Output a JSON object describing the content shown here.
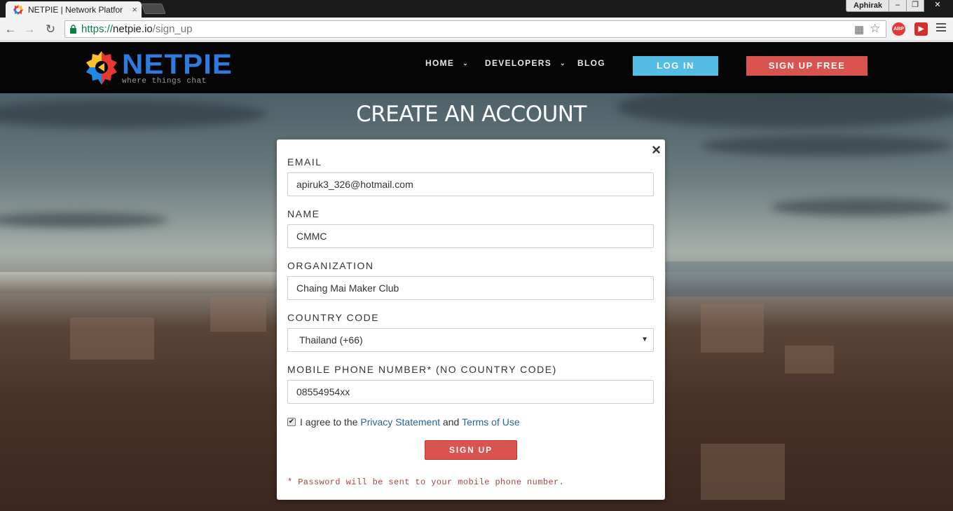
{
  "browser": {
    "tab_title": "NETPIE | Network Platfor",
    "tab_close": "×",
    "profile_name": "Aphirak",
    "url_scheme": "https://",
    "url_host": "netpie.io",
    "url_path": "/sign_up",
    "icons": [
      "back-icon",
      "forward-icon",
      "reload-icon",
      "lock-icon",
      "translate-icon",
      "star-icon",
      "adblock-icon",
      "extension-icon",
      "menu-icon"
    ],
    "adblock_label": "ABP"
  },
  "site": {
    "logo_text": "NETPIE",
    "logo_tagline": "where things chat",
    "nav": [
      {
        "label": "HOME",
        "has_dropdown": true
      },
      {
        "label": "DEVELOPERS",
        "has_dropdown": true
      },
      {
        "label": "BLOG",
        "has_dropdown": false
      }
    ],
    "login_label": "LOG IN",
    "signup_label": "SIGN UP FREE",
    "colors": {
      "login": "#54bde4",
      "signup": "#d9534f",
      "header_bg": "#050505"
    }
  },
  "page": {
    "title": "CREATE AN ACCOUNT"
  },
  "form": {
    "close_label": "×",
    "email_label": "EMAIL",
    "email_value": "apiruk3_326@hotmail.com",
    "name_label": "NAME",
    "name_value": "CMMC",
    "org_label": "ORGANIZATION",
    "org_value": "Chaing Mai Maker Club",
    "country_label": "COUNTRY CODE",
    "country_value": "Thailand (+66)",
    "phone_label": "MOBILE PHONE NUMBER* (NO COUNTRY CODE)",
    "phone_value": "08554954xx",
    "agree_checked": true,
    "agree_prefix": "I agree to the",
    "privacy_link": "Privacy Statement",
    "agree_and": "and",
    "terms_link": "Terms of Use",
    "submit_label": "SIGN UP",
    "note": "* Password will be sent to your mobile phone number."
  }
}
